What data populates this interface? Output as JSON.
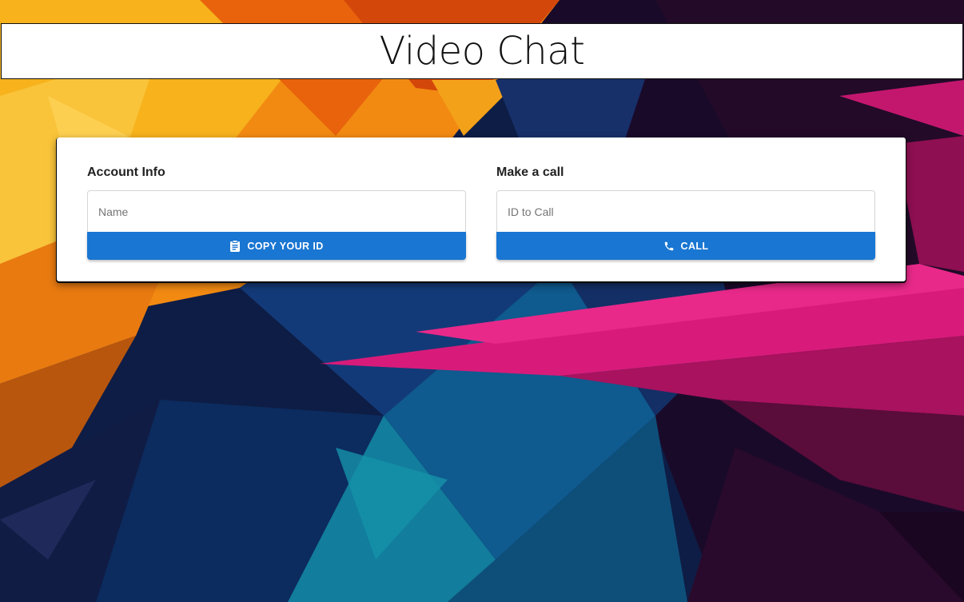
{
  "header": {
    "title": "Video Chat"
  },
  "account": {
    "heading": "Account Info",
    "name_placeholder": "Name",
    "name_value": "",
    "copy_button_label": "COPY YOUR ID",
    "copy_button_icon": "clipboard-icon"
  },
  "call": {
    "heading": "Make a call",
    "id_placeholder": "ID to Call",
    "id_value": "",
    "call_button_label": "CALL",
    "call_button_icon": "phone-icon"
  },
  "colors": {
    "primary": "#1976d2",
    "card": "#ffffff",
    "title_bar": "#ffffff"
  }
}
